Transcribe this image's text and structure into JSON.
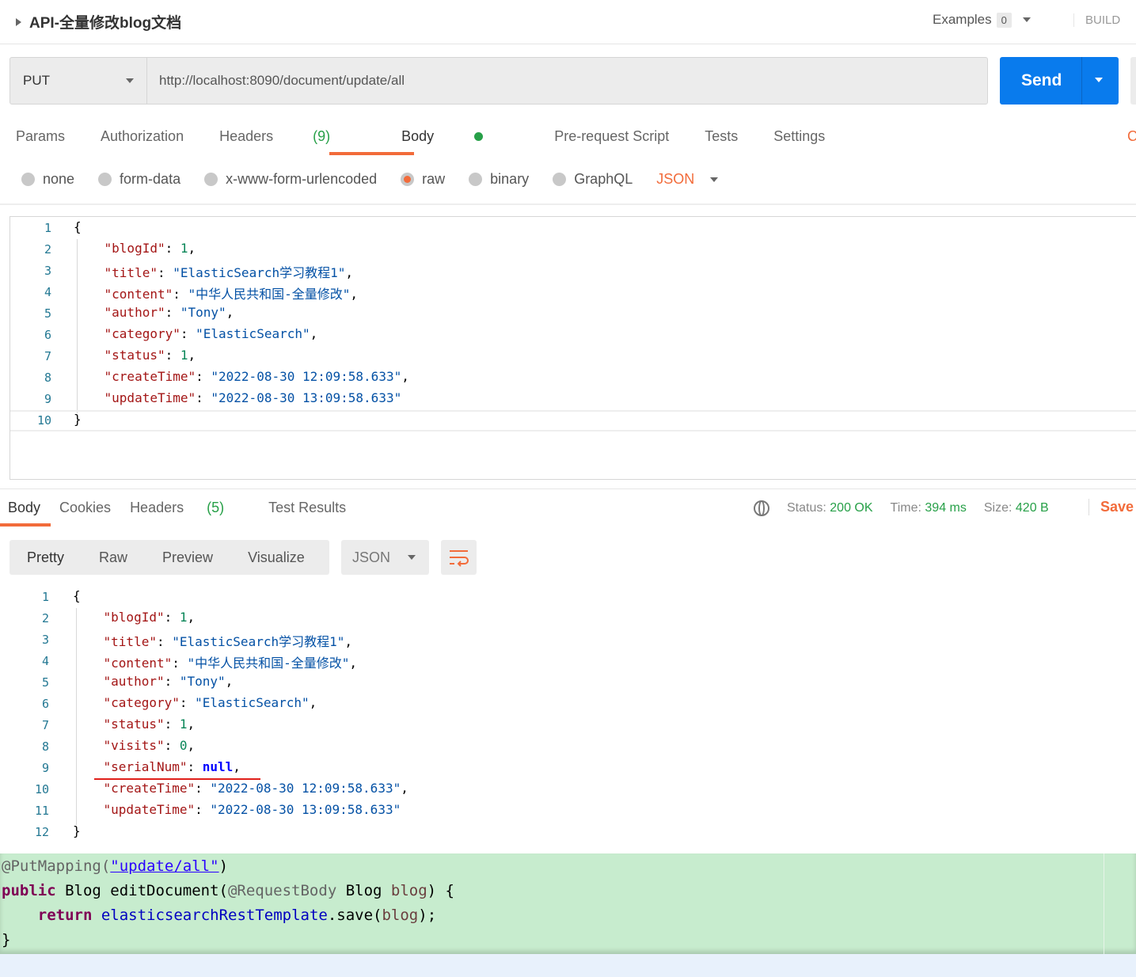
{
  "header": {
    "title": "API-全量修改blog文档",
    "examples_label": "Examples",
    "examples_count": "0",
    "build_label": "BUILD"
  },
  "request": {
    "method": "PUT",
    "url": "http://localhost:8090/document/update/all",
    "send_label": "Send"
  },
  "tabs": [
    {
      "label": "Params"
    },
    {
      "label": "Authorization"
    },
    {
      "label": "Headers",
      "count": "(9)"
    },
    {
      "label": "Body",
      "active": true
    },
    {
      "label": "Pre-request Script"
    },
    {
      "label": "Tests"
    },
    {
      "label": "Settings"
    }
  ],
  "body_types": [
    {
      "label": "none"
    },
    {
      "label": "form-data"
    },
    {
      "label": "x-www-form-urlencoded"
    },
    {
      "label": "raw",
      "selected": true
    },
    {
      "label": "binary"
    },
    {
      "label": "GraphQL"
    }
  ],
  "body_format": "JSON",
  "request_body": [
    [
      [
        "{",
        "p"
      ]
    ],
    [
      [
        "    ",
        "p"
      ],
      [
        "\"blogId\"",
        "k"
      ],
      [
        ": ",
        "p"
      ],
      [
        "1",
        "n"
      ],
      [
        ",",
        "p"
      ]
    ],
    [
      [
        "    ",
        "p"
      ],
      [
        "\"title\"",
        "k"
      ],
      [
        ": ",
        "p"
      ],
      [
        "\"ElasticSearch学习教程1\"",
        "s"
      ],
      [
        ",",
        "p"
      ]
    ],
    [
      [
        "    ",
        "p"
      ],
      [
        "\"content\"",
        "k"
      ],
      [
        ": ",
        "p"
      ],
      [
        "\"中华人民共和国-全量修改\"",
        "s"
      ],
      [
        ",",
        "p"
      ]
    ],
    [
      [
        "    ",
        "p"
      ],
      [
        "\"author\"",
        "k"
      ],
      [
        ": ",
        "p"
      ],
      [
        "\"Tony\"",
        "s"
      ],
      [
        ",",
        "p"
      ]
    ],
    [
      [
        "    ",
        "p"
      ],
      [
        "\"category\"",
        "k"
      ],
      [
        ": ",
        "p"
      ],
      [
        "\"ElasticSearch\"",
        "s"
      ],
      [
        ",",
        "p"
      ]
    ],
    [
      [
        "    ",
        "p"
      ],
      [
        "\"status\"",
        "k"
      ],
      [
        ": ",
        "p"
      ],
      [
        "1",
        "n"
      ],
      [
        ",",
        "p"
      ]
    ],
    [
      [
        "    ",
        "p"
      ],
      [
        "\"createTime\"",
        "k"
      ],
      [
        ": ",
        "p"
      ],
      [
        "\"2022-08-30 12:09:58.633\"",
        "s"
      ],
      [
        ",",
        "p"
      ]
    ],
    [
      [
        "    ",
        "p"
      ],
      [
        "\"updateTime\"",
        "k"
      ],
      [
        ": ",
        "p"
      ],
      [
        "\"2022-08-30 13:09:58.633\"",
        "s"
      ]
    ],
    [
      [
        "}",
        "p"
      ]
    ]
  ],
  "response": {
    "tabs": [
      {
        "label": "Body",
        "active": true
      },
      {
        "label": "Cookies"
      },
      {
        "label": "Headers",
        "count": "(5)"
      },
      {
        "label": "Test Results"
      }
    ],
    "status_label": "Status:",
    "status": "200 OK",
    "time_label": "Time:",
    "time": "394 ms",
    "size_label": "Size:",
    "size": "420 B",
    "save_label": "Save",
    "views": [
      "Pretty",
      "Raw",
      "Preview",
      "Visualize"
    ],
    "format": "JSON",
    "body": [
      [
        [
          "{",
          "p"
        ]
      ],
      [
        [
          "    ",
          "p"
        ],
        [
          "\"blogId\"",
          "k"
        ],
        [
          ": ",
          "p"
        ],
        [
          "1",
          "n"
        ],
        [
          ",",
          "p"
        ]
      ],
      [
        [
          "    ",
          "p"
        ],
        [
          "\"title\"",
          "k"
        ],
        [
          ": ",
          "p"
        ],
        [
          "\"ElasticSearch学习教程1\"",
          "s"
        ],
        [
          ",",
          "p"
        ]
      ],
      [
        [
          "    ",
          "p"
        ],
        [
          "\"content\"",
          "k"
        ],
        [
          ": ",
          "p"
        ],
        [
          "\"中华人民共和国-全量修改\"",
          "s"
        ],
        [
          ",",
          "p"
        ]
      ],
      [
        [
          "    ",
          "p"
        ],
        [
          "\"author\"",
          "k"
        ],
        [
          ": ",
          "p"
        ],
        [
          "\"Tony\"",
          "s"
        ],
        [
          ",",
          "p"
        ]
      ],
      [
        [
          "    ",
          "p"
        ],
        [
          "\"category\"",
          "k"
        ],
        [
          ": ",
          "p"
        ],
        [
          "\"ElasticSearch\"",
          "s"
        ],
        [
          ",",
          "p"
        ]
      ],
      [
        [
          "    ",
          "p"
        ],
        [
          "\"status\"",
          "k"
        ],
        [
          ": ",
          "p"
        ],
        [
          "1",
          "n"
        ],
        [
          ",",
          "p"
        ]
      ],
      [
        [
          "    ",
          "p"
        ],
        [
          "\"visits\"",
          "k"
        ],
        [
          ": ",
          "p"
        ],
        [
          "0",
          "n"
        ],
        [
          ",",
          "p"
        ]
      ],
      [
        [
          "    ",
          "p"
        ],
        [
          "\"serialNum\"",
          "k"
        ],
        [
          ": ",
          "p"
        ],
        [
          "null",
          "b"
        ],
        [
          ",",
          "p"
        ]
      ],
      [
        [
          "    ",
          "p"
        ],
        [
          "\"createTime\"",
          "k"
        ],
        [
          ": ",
          "p"
        ],
        [
          "\"2022-08-30 12:09:58.633\"",
          "s"
        ],
        [
          ",",
          "p"
        ]
      ],
      [
        [
          "    ",
          "p"
        ],
        [
          "\"updateTime\"",
          "k"
        ],
        [
          ": ",
          "p"
        ],
        [
          "\"2022-08-30 13:09:58.633\"",
          "s"
        ]
      ],
      [
        [
          "}",
          "p"
        ]
      ]
    ]
  },
  "java_code": [
    [
      [
        "@PutMapping(",
        "ann"
      ],
      [
        "\"update/all\"",
        "js"
      ],
      [
        ")",
        "p"
      ]
    ],
    [
      [
        "public",
        "jk"
      ],
      [
        " Blog editDocument(",
        "p"
      ],
      [
        "@RequestBody",
        "ann"
      ],
      [
        " Blog ",
        "p"
      ],
      [
        "blog",
        "jvar"
      ],
      [
        ") {",
        "p"
      ]
    ],
    [
      [
        "    ",
        "p"
      ],
      [
        "return",
        "jk"
      ],
      [
        " ",
        "p"
      ],
      [
        "elasticsearchRestTemplate",
        "jf"
      ],
      [
        ".save(",
        "p"
      ],
      [
        "blog",
        "jvar"
      ],
      [
        ");",
        "p"
      ]
    ],
    [
      [
        "}",
        "p"
      ]
    ]
  ],
  "colors": {
    "accent": "#f26b3a",
    "send": "#097bed",
    "ok": "#27a048",
    "highlight": "#c7ecce"
  }
}
